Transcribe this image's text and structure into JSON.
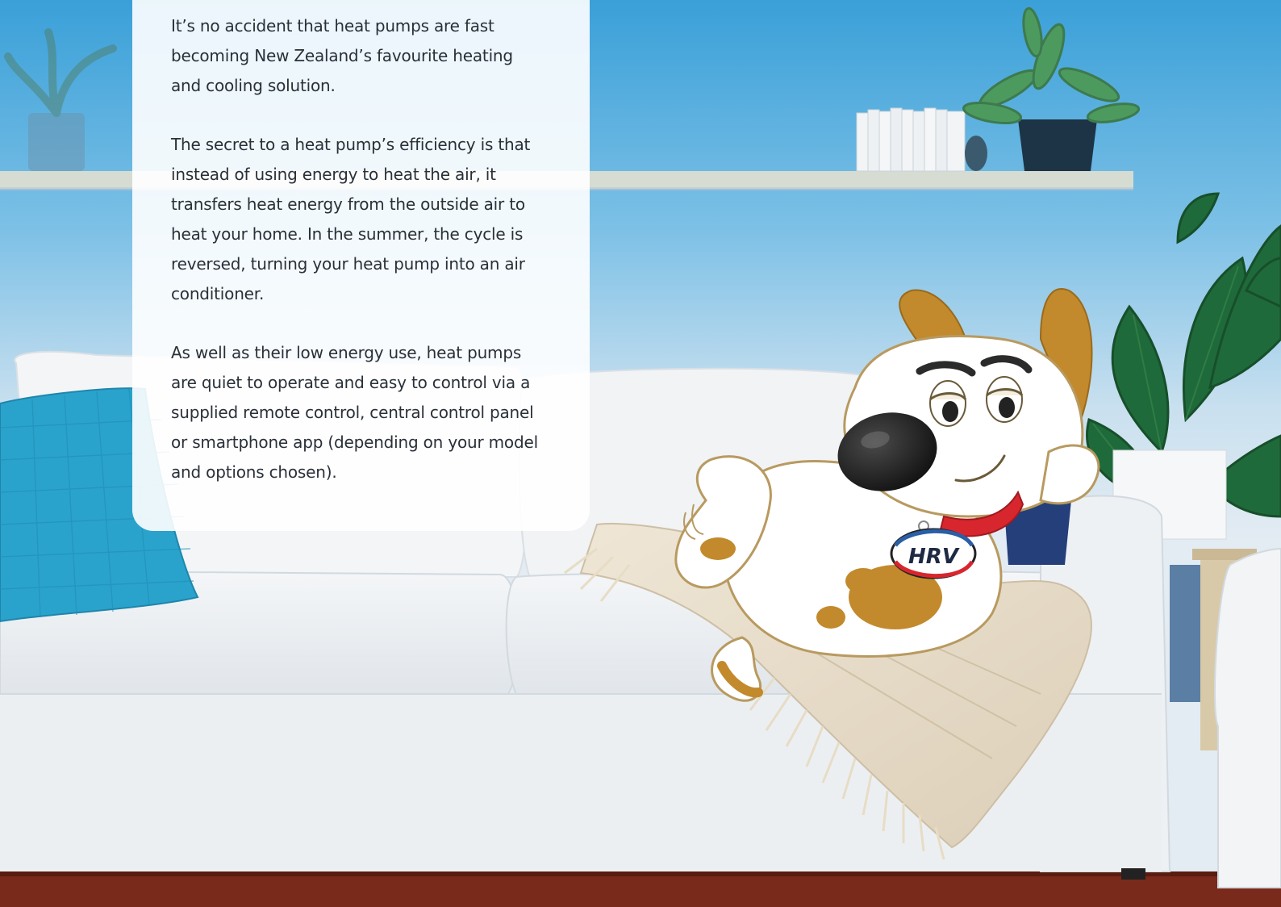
{
  "brochure": {
    "paragraphs": [
      {
        "lines": [
          "It’s no accident that heat pumps are fast",
          "becoming New Zealand’s favourite heating",
          "and cooling solution."
        ]
      },
      {
        "lines": [
          "The secret to a heat pump’s efficiency is that",
          "instead of using energy to heat the air, it",
          "transfers heat energy from the outside air to",
          "heat your home. In the summer, the cycle is",
          "reversed, turning your heat pump into an air",
          "conditioner."
        ]
      },
      {
        "lines": [
          "As well as their low energy use, heat pumps",
          "are quiet to operate and easy to control via a",
          "supplied remote control, central control panel",
          "or smartphone app (depending on your model",
          "and options chosen)."
        ]
      }
    ]
  },
  "mascot": {
    "badge_text": "HRV"
  },
  "colors": {
    "sky_blue": "#3a9fd6",
    "cushion_teal": "#2aa3cc",
    "mascot_tan": "#c28a2c",
    "collar_red": "#d8262e",
    "badge_blue": "#2a5fa8",
    "badge_red": "#d8262e",
    "floor_wood": "#7a2a1a"
  }
}
